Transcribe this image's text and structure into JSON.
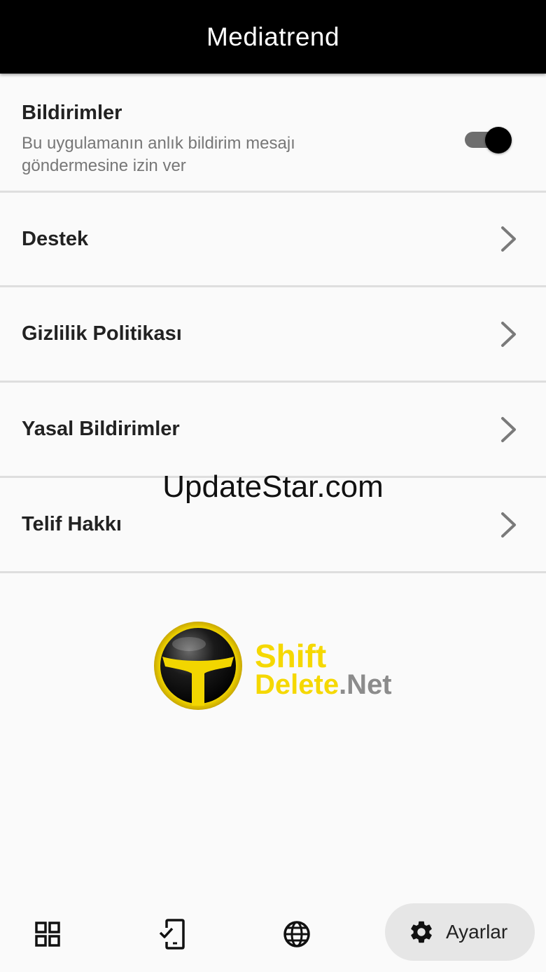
{
  "app_bar": {
    "title": "Mediatrend"
  },
  "notifications": {
    "title": "Bildirimler",
    "subtitle": "Bu uygulamanın anlık bildirim mesajı göndermesine izin ver",
    "enabled": true
  },
  "menu": {
    "items": [
      {
        "label": "Destek",
        "icon": "chevron-right-icon"
      },
      {
        "label": "Gizlilik Politikası",
        "icon": "chevron-right-icon"
      },
      {
        "label": "Yasal Bildirimler",
        "icon": "chevron-right-icon"
      },
      {
        "label": "Telif Hakkı",
        "icon": "chevron-right-icon"
      }
    ]
  },
  "watermark": "UpdateStar.com",
  "logo": {
    "line1": "Shift",
    "line2_a": "Delete",
    "line2_b": ".Net"
  },
  "bottom_nav": {
    "items": [
      {
        "icon": "grid-icon"
      },
      {
        "icon": "phone-check-icon"
      },
      {
        "icon": "globe-icon"
      },
      {
        "icon": "gear-icon",
        "label": "Ayarlar",
        "selected": true
      }
    ]
  },
  "colors": {
    "app_bar": "#000000",
    "background": "#fafafa",
    "logo_yellow": "#f5d800",
    "logo_gray": "#8c8c8c",
    "selected_nav_bg": "#e6e6e6"
  }
}
